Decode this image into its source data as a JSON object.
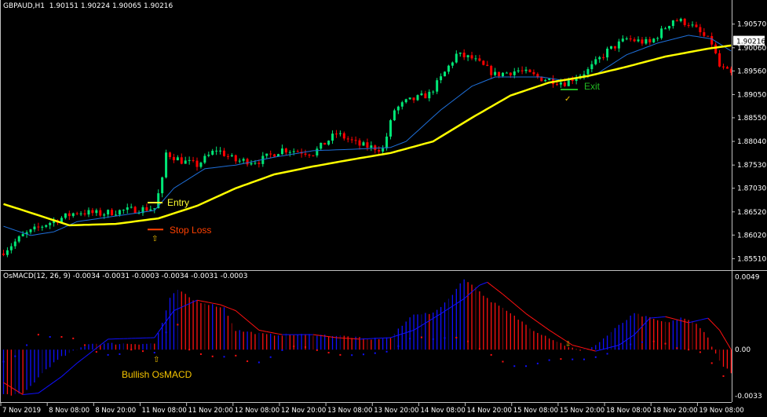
{
  "header": {
    "symbol": "GBPAUD,H1",
    "open": "1.90151",
    "high": "1.90224",
    "low": "1.90065",
    "close": "1.90216"
  },
  "indicator_header": {
    "name": "OsMACD(12, 26, 9)",
    "values": "-0.0034 -0.0031 -0.0003 -0.0034 -0.0031 -0.0003"
  },
  "price_axis": {
    "labels": [
      "1.90570",
      "1.90060",
      "1.89560",
      "1.89050",
      "1.88550",
      "1.88040",
      "1.87530",
      "1.87030",
      "1.86520",
      "1.86020",
      "1.85510"
    ],
    "current_price": "1.90216"
  },
  "indicator_axis": {
    "labels": [
      "0.0049",
      "0.00",
      "-0.0033"
    ]
  },
  "time_axis": {
    "labels": [
      "7 Nov 2019",
      "8 Nov 08:00",
      "8 Nov 20:00",
      "11 Nov 08:00",
      "11 Nov 20:00",
      "12 Nov 08:00",
      "12 Nov 20:00",
      "13 Nov 08:00",
      "13 Nov 20:00",
      "14 Nov 08:00",
      "14 Nov 20:00",
      "15 Nov 08:00",
      "15 Nov 20:00",
      "18 Nov 08:00",
      "18 Nov 20:00",
      "19 Nov 08:00"
    ]
  },
  "annotations": {
    "entry": "Entry",
    "stop_loss": "Stop Loss",
    "exit": "Exit",
    "bullish": "Bullish OsMACD",
    "entry_price": 1.8672,
    "stop_price": 1.8614,
    "exit_price": 1.8916
  },
  "colors": {
    "background": "#000000",
    "bull": "#00e676",
    "bear": "#ff0000",
    "slow_ma": "#ffff00",
    "fast_ma": "#1e6fd9",
    "hist_up": "#1010ff",
    "hist_down": "#ff1010",
    "entry": "#ffff33",
    "stop": "#ff4000",
    "exit": "#22bb22",
    "label": "#f5c400"
  },
  "chart_data": [
    {
      "type": "candlestick",
      "title": "GBPAUD,H1",
      "timeframe": "H1",
      "bars": 189,
      "ylim": [
        1.8528,
        1.9109
      ],
      "close_path": [
        [
          0,
          1.8567
        ],
        [
          5,
          1.8601
        ],
        [
          11,
          1.8626
        ],
        [
          19,
          1.8652
        ],
        [
          25,
          1.8648
        ],
        [
          31,
          1.8655
        ],
        [
          39,
          1.866
        ],
        [
          41,
          1.872
        ],
        [
          42,
          1.8779
        ],
        [
          46,
          1.8762
        ],
        [
          50,
          1.8753
        ],
        [
          55,
          1.8787
        ],
        [
          60,
          1.8762
        ],
        [
          66,
          1.8762
        ],
        [
          72,
          1.8787
        ],
        [
          80,
          1.8779
        ],
        [
          86,
          1.8821
        ],
        [
          92,
          1.8796
        ],
        [
          98,
          1.8787
        ],
        [
          101,
          1.8872
        ],
        [
          104,
          1.8889
        ],
        [
          110,
          1.8906
        ],
        [
          113,
          1.894
        ],
        [
          117,
          1.8991
        ],
        [
          121,
          1.8983
        ],
        [
          127,
          1.8948
        ],
        [
          133,
          1.8957
        ],
        [
          139,
          1.894
        ],
        [
          145,
          1.8931
        ],
        [
          151,
          1.8957
        ],
        [
          156,
          1.8999
        ],
        [
          161,
          1.9025
        ],
        [
          167,
          1.9016
        ],
        [
          173,
          1.9067
        ],
        [
          177,
          1.9059
        ],
        [
          183,
          1.9016
        ],
        [
          185,
          1.8965
        ],
        [
          188,
          1.8948
        ]
      ],
      "slow_ma": [
        [
          0,
          1.8669
        ],
        [
          17,
          1.8623
        ],
        [
          29,
          1.8626
        ],
        [
          40,
          1.8638
        ],
        [
          50,
          1.8665
        ],
        [
          60,
          1.8703
        ],
        [
          70,
          1.8733
        ],
        [
          80,
          1.875
        ],
        [
          90,
          1.8765
        ],
        [
          100,
          1.8779
        ],
        [
          111,
          1.8804
        ],
        [
          121,
          1.8855
        ],
        [
          131,
          1.8903
        ],
        [
          141,
          1.8931
        ],
        [
          151,
          1.8945
        ],
        [
          161,
          1.8965
        ],
        [
          171,
          1.8987
        ],
        [
          182,
          1.9004
        ],
        [
          188,
          1.9011
        ]
      ],
      "fast_ma": [
        [
          0,
          1.8621
        ],
        [
          7,
          1.8601
        ],
        [
          13,
          1.8609
        ],
        [
          19,
          1.8631
        ],
        [
          29,
          1.8643
        ],
        [
          39,
          1.8655
        ],
        [
          44,
          1.8703
        ],
        [
          52,
          1.8745
        ],
        [
          60,
          1.8753
        ],
        [
          70,
          1.877
        ],
        [
          80,
          1.8784
        ],
        [
          90,
          1.8787
        ],
        [
          100,
          1.8791
        ],
        [
          104,
          1.8804
        ],
        [
          113,
          1.8872
        ],
        [
          121,
          1.8923
        ],
        [
          127,
          1.8943
        ],
        [
          139,
          1.8943
        ],
        [
          145,
          1.8935
        ],
        [
          153,
          1.8948
        ],
        [
          161,
          1.8991
        ],
        [
          169,
          1.9016
        ],
        [
          177,
          1.9033
        ],
        [
          183,
          1.9025
        ],
        [
          188,
          1.8999
        ]
      ]
    },
    {
      "type": "bar",
      "title": "OsMACD(12, 26, 9)",
      "ylim": [
        -0.0035,
        0.0052
      ],
      "histogram": [
        [
          0,
          -0.003
        ],
        [
          5,
          -0.003
        ],
        [
          11,
          -0.0013
        ],
        [
          15,
          -0.0005
        ],
        [
          19,
          0.0
        ],
        [
          22,
          0.0004
        ],
        [
          39,
          0.0004
        ],
        [
          41,
          0.0018
        ],
        [
          43,
          0.0034
        ],
        [
          45,
          0.004
        ],
        [
          49,
          0.0033
        ],
        [
          57,
          0.0028
        ],
        [
          60,
          0.0013
        ],
        [
          68,
          0.001
        ],
        [
          80,
          0.001
        ],
        [
          88,
          0.0009
        ],
        [
          94,
          0.0007
        ],
        [
          100,
          0.0008
        ],
        [
          103,
          0.0016
        ],
        [
          106,
          0.0024
        ],
        [
          111,
          0.0024
        ],
        [
          115,
          0.0034
        ],
        [
          119,
          0.0047
        ],
        [
          121,
          0.0044
        ],
        [
          125,
          0.0034
        ],
        [
          131,
          0.0024
        ],
        [
          137,
          0.0013
        ],
        [
          141,
          0.0008
        ],
        [
          145,
          0.0003
        ],
        [
          149,
          -0.0001
        ],
        [
          153,
          0.0003
        ],
        [
          159,
          0.0016
        ],
        [
          163,
          0.0024
        ],
        [
          167,
          0.0021
        ],
        [
          171,
          0.0018
        ],
        [
          175,
          0.0021
        ],
        [
          179,
          0.0018
        ],
        [
          182,
          0.0008
        ],
        [
          185,
          -0.0008
        ],
        [
          188,
          -0.0016
        ]
      ],
      "signal_line": [
        [
          0,
          -0.0022
        ],
        [
          5,
          -0.003
        ],
        [
          9,
          -0.0029
        ],
        [
          15,
          -0.0018
        ],
        [
          19,
          -0.0009
        ],
        [
          25,
          0.0003
        ],
        [
          27,
          0.0007
        ],
        [
          39,
          0.0008
        ],
        [
          44,
          0.0026
        ],
        [
          50,
          0.0033
        ],
        [
          56,
          0.003
        ],
        [
          60,
          0.0026
        ],
        [
          66,
          0.0013
        ],
        [
          72,
          0.001
        ],
        [
          80,
          0.001
        ],
        [
          86,
          0.0008
        ],
        [
          92,
          0.0007
        ],
        [
          100,
          0.0008
        ],
        [
          106,
          0.0013
        ],
        [
          113,
          0.0024
        ],
        [
          119,
          0.0034
        ],
        [
          123,
          0.0043
        ],
        [
          125,
          0.0045
        ],
        [
          129,
          0.0037
        ],
        [
          135,
          0.0024
        ],
        [
          141,
          0.0013
        ],
        [
          147,
          0.0003
        ],
        [
          153,
          -0.0001
        ],
        [
          159,
          0.0003
        ],
        [
          163,
          0.001
        ],
        [
          167,
          0.0021
        ],
        [
          171,
          0.0022
        ],
        [
          177,
          0.0018
        ],
        [
          182,
          0.0021
        ],
        [
          185,
          0.0013
        ],
        [
          188,
          0.0
        ]
      ],
      "dotted_line": [
        [
          0,
          -0.0008
        ],
        [
          5,
          -0.0002
        ],
        [
          7,
          0.0008
        ],
        [
          9,
          0.001
        ],
        [
          13,
          0.0008
        ],
        [
          17,
          0.0009
        ],
        [
          21,
          0.0003
        ],
        [
          25,
          -0.0003
        ],
        [
          29,
          -0.0004
        ],
        [
          33,
          0.0
        ],
        [
          39,
          -0.0002
        ],
        [
          43,
          0.0016
        ],
        [
          46,
          0.0017
        ],
        [
          48,
          0.0
        ],
        [
          52,
          -0.0004
        ],
        [
          56,
          -0.0005
        ],
        [
          60,
          -0.0004
        ],
        [
          64,
          -0.0009
        ],
        [
          68,
          -0.0008
        ],
        [
          70,
          -0.0002
        ],
        [
          76,
          0.0003
        ],
        [
          82,
          -0.0001
        ],
        [
          88,
          -0.0004
        ],
        [
          94,
          -0.0003
        ],
        [
          100,
          -0.0001
        ],
        [
          106,
          0.0009
        ],
        [
          111,
          0.0007
        ],
        [
          115,
          0.0008
        ],
        [
          119,
          0.0008
        ],
        [
          121,
          0.0003
        ],
        [
          125,
          -0.0002
        ],
        [
          129,
          -0.0008
        ],
        [
          133,
          -0.0012
        ],
        [
          137,
          -0.001
        ],
        [
          141,
          -0.0007
        ],
        [
          145,
          -0.0006
        ],
        [
          149,
          -0.0007
        ],
        [
          153,
          -0.0005
        ],
        [
          157,
          -0.0002
        ],
        [
          161,
          0.0003
        ],
        [
          167,
          0.0006
        ],
        [
          171,
          0.0004
        ],
        [
          175,
          0.0
        ],
        [
          179,
          0.0
        ],
        [
          182,
          -0.0005
        ],
        [
          185,
          -0.0017
        ],
        [
          188,
          -0.0019
        ]
      ]
    }
  ]
}
